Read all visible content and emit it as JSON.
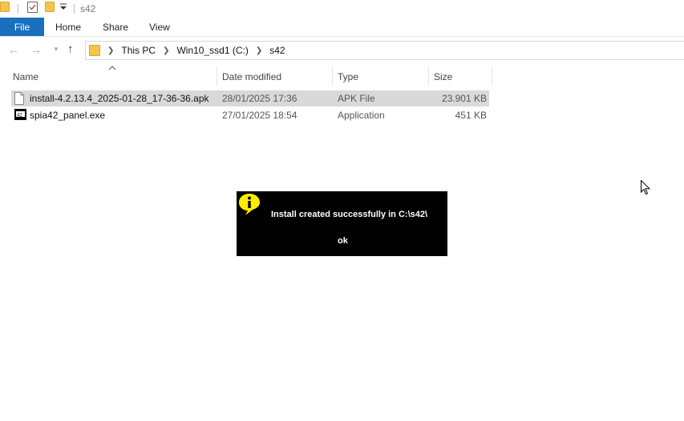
{
  "window": {
    "title": "s42"
  },
  "ribbon": {
    "file_tab": "File",
    "tabs": [
      "Home",
      "Share",
      "View"
    ]
  },
  "address_bar": {
    "crumbs": [
      "This PC",
      "Win10_ssd1 (C:)",
      "s42"
    ]
  },
  "columns": {
    "name": "Name",
    "date_modified": "Date modified",
    "type": "Type",
    "size": "Size"
  },
  "files": [
    {
      "name": "install-4.2.13.4_2025-01-28_17-36-36.apk",
      "date_modified": "28/01/2025 17:36",
      "type": "APK File",
      "size": "23.901 KB",
      "icon": "document-icon",
      "selected": true
    },
    {
      "name": "spia42_panel.exe",
      "date_modified": "27/01/2025 18:54",
      "type": "Application",
      "size": "451 KB",
      "icon": "app-icon",
      "selected": false
    }
  ],
  "dialog": {
    "message": "Install created successfully in C:\\s42\\",
    "ok_label": "ok",
    "icon": "info-icon"
  },
  "colors": {
    "file_tab": "#1a6fbf",
    "selection": "#d9d9d9",
    "dialog_bg": "#000000",
    "info_icon": "#ffeb00"
  }
}
